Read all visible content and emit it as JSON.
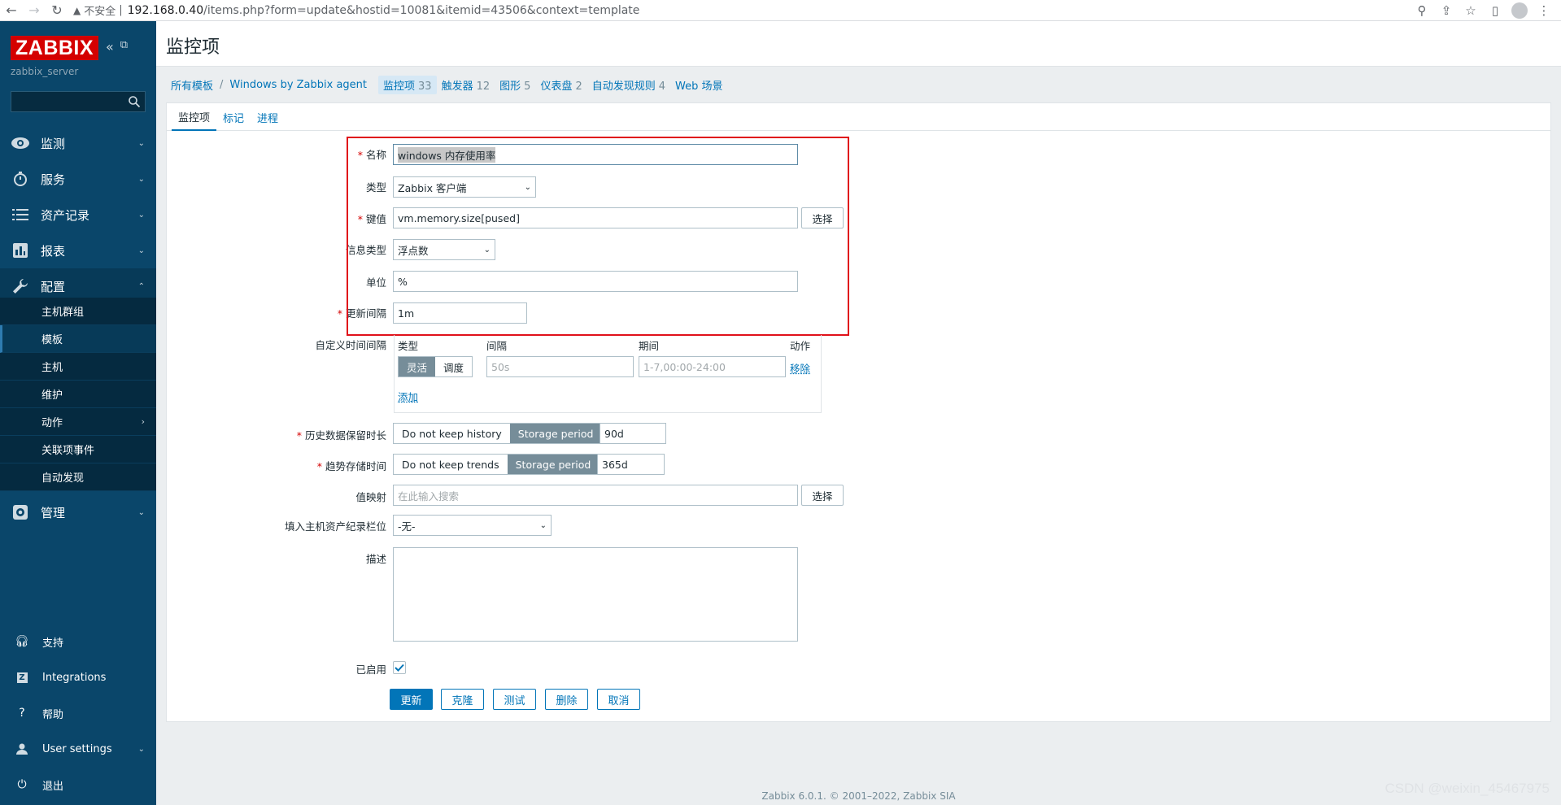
{
  "browser": {
    "insecure_label": "不安全",
    "url_host": "192.168.0.40",
    "url_path": "/items.php?form=update&hostid=10081&itemid=43506&context=template"
  },
  "sidebar": {
    "logo": "ZABBIX",
    "server_name": "zabbix_server",
    "search_placeholder": "",
    "nav": [
      {
        "label": "监测",
        "icon": "eye-icon"
      },
      {
        "label": "服务",
        "icon": "stopwatch-icon"
      },
      {
        "label": "资产记录",
        "icon": "list-icon"
      },
      {
        "label": "报表",
        "icon": "bar-chart-icon"
      },
      {
        "label": "配置",
        "icon": "wrench-icon"
      },
      {
        "label": "管理",
        "icon": "gear-icon"
      }
    ],
    "submenu": [
      {
        "label": "主机群组"
      },
      {
        "label": "模板"
      },
      {
        "label": "主机"
      },
      {
        "label": "维护"
      },
      {
        "label": "动作"
      },
      {
        "label": "关联项事件"
      },
      {
        "label": "自动发现"
      }
    ],
    "bottom": [
      {
        "label": "支持",
        "icon": "headset-icon"
      },
      {
        "label": "Integrations",
        "icon": "integrations-icon"
      },
      {
        "label": "帮助",
        "icon": "help-icon"
      },
      {
        "label": "User settings",
        "icon": "user-icon"
      },
      {
        "label": "退出",
        "icon": "power-icon"
      }
    ]
  },
  "header": {
    "title": "监控项"
  },
  "breadcrumbs": {
    "all_templates": "所有模板",
    "template": "Windows by Zabbix agent",
    "items": {
      "label": "监控项",
      "count": "33"
    },
    "triggers": {
      "label": "触发器",
      "count": "12"
    },
    "graphs": {
      "label": "图形",
      "count": "5"
    },
    "dashboards": {
      "label": "仪表盘",
      "count": "2"
    },
    "discovery": {
      "label": "自动发现规则",
      "count": "4"
    },
    "web": {
      "label": "Web 场景"
    }
  },
  "tabs": [
    "监控项",
    "标记",
    "进程"
  ],
  "form": {
    "name": {
      "label": "名称",
      "value": "windows 内存使用率"
    },
    "type": {
      "label": "类型",
      "value": "Zabbix 客户端"
    },
    "key": {
      "label": "键值",
      "value": "vm.memory.size[pused]",
      "button": "选择"
    },
    "info_type": {
      "label": "信息类型",
      "value": "浮点数"
    },
    "units": {
      "label": "单位",
      "value": "%"
    },
    "interval": {
      "label": "更新间隔",
      "value": "1m"
    },
    "custom_intervals": {
      "label": "自定义时间间隔",
      "headers": [
        "类型",
        "间隔",
        "期间",
        "动作"
      ],
      "mode_flexible": "灵活",
      "mode_scheduling": "调度",
      "interval_placeholder": "50s",
      "period_placeholder": "1-7,00:00-24:00",
      "remove": "移除",
      "add": "添加"
    },
    "history": {
      "label": "历史数据保留时长",
      "opt_off": "Do not keep history",
      "opt_on": "Storage period",
      "value": "90d"
    },
    "trends": {
      "label": "趋势存储时间",
      "opt_off": "Do not keep trends",
      "opt_on": "Storage period",
      "value": "365d"
    },
    "valuemap": {
      "label": "值映射",
      "placeholder": "在此输入搜索",
      "button": "选择"
    },
    "inventory": {
      "label": "填入主机资产纪录栏位",
      "value": "-无-"
    },
    "description": {
      "label": "描述",
      "value": ""
    },
    "enabled": {
      "label": "已启用",
      "checked": true
    },
    "buttons": {
      "update": "更新",
      "clone": "克隆",
      "test": "测试",
      "delete": "删除",
      "cancel": "取消"
    }
  },
  "footer": "Zabbix 6.0.1. © 2001–2022, Zabbix SIA",
  "watermark": "CSDN @weixin_45467975",
  "colors": {
    "sidebar": "#0a466a",
    "brand_red": "#d40000",
    "link": "#0275b8",
    "highlight_box": "#e0111a"
  }
}
